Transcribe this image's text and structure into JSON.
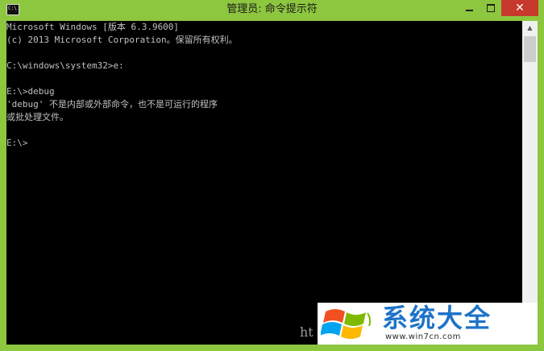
{
  "window": {
    "title": "管理员: 命令提示符",
    "icon_text": "C:\\",
    "close_glyph": "✕",
    "scroll_up_glyph": "▲",
    "scroll_down_glyph": "▼"
  },
  "console": {
    "lines": [
      "Microsoft Windows [版本 6.3.9600]",
      "(c) 2013 Microsoft Corporation。保留所有权利。",
      "",
      "C:\\windows\\system32>e:",
      "",
      "E:\\>debug",
      "'debug' 不是内部或外部命令，也不是可运行的程序",
      "或批处理文件。",
      "",
      "E:\\>"
    ]
  },
  "watermark": {
    "brand": "系统大全",
    "url": "www.win7cn.com",
    "left_text": "ht"
  },
  "colors": {
    "titlebar": "#8dc63f",
    "close_button": "#c7392c",
    "console_bg": "#000000",
    "console_text": "#c0c0c0",
    "brand_blue": "#1e73c8"
  },
  "icons": [
    "cmd-app-icon",
    "minimize-icon",
    "maximize-icon",
    "close-icon",
    "windows-logo-icon"
  ]
}
